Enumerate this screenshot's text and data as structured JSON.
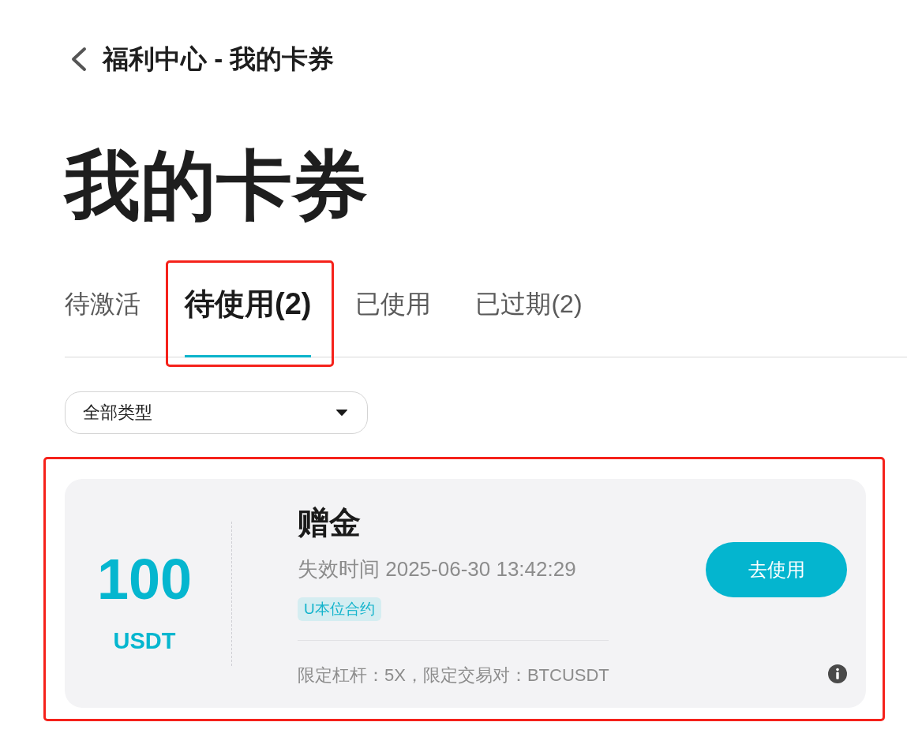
{
  "header": {
    "title": "福利中心 - 我的卡券"
  },
  "page_title": "我的卡券",
  "tabs": [
    {
      "label": "待激活",
      "selected": false,
      "highlighted": false
    },
    {
      "label": "待使用(2)",
      "selected": true,
      "highlighted": true
    },
    {
      "label": "已使用",
      "selected": false,
      "highlighted": false
    },
    {
      "label": "已过期(2)",
      "selected": false,
      "highlighted": false
    }
  ],
  "type_filter": {
    "value": "全部类型"
  },
  "coupons": [
    {
      "amount": "100",
      "currency": "USDT",
      "title": "赠金",
      "expiry": "失效时间 2025-06-30 13:42:29",
      "tag": "U本位合约",
      "restrictions": "限定杠杆：5X，限定交易对：BTCUSDT",
      "action": "去使用",
      "highlighted": true
    }
  ]
}
